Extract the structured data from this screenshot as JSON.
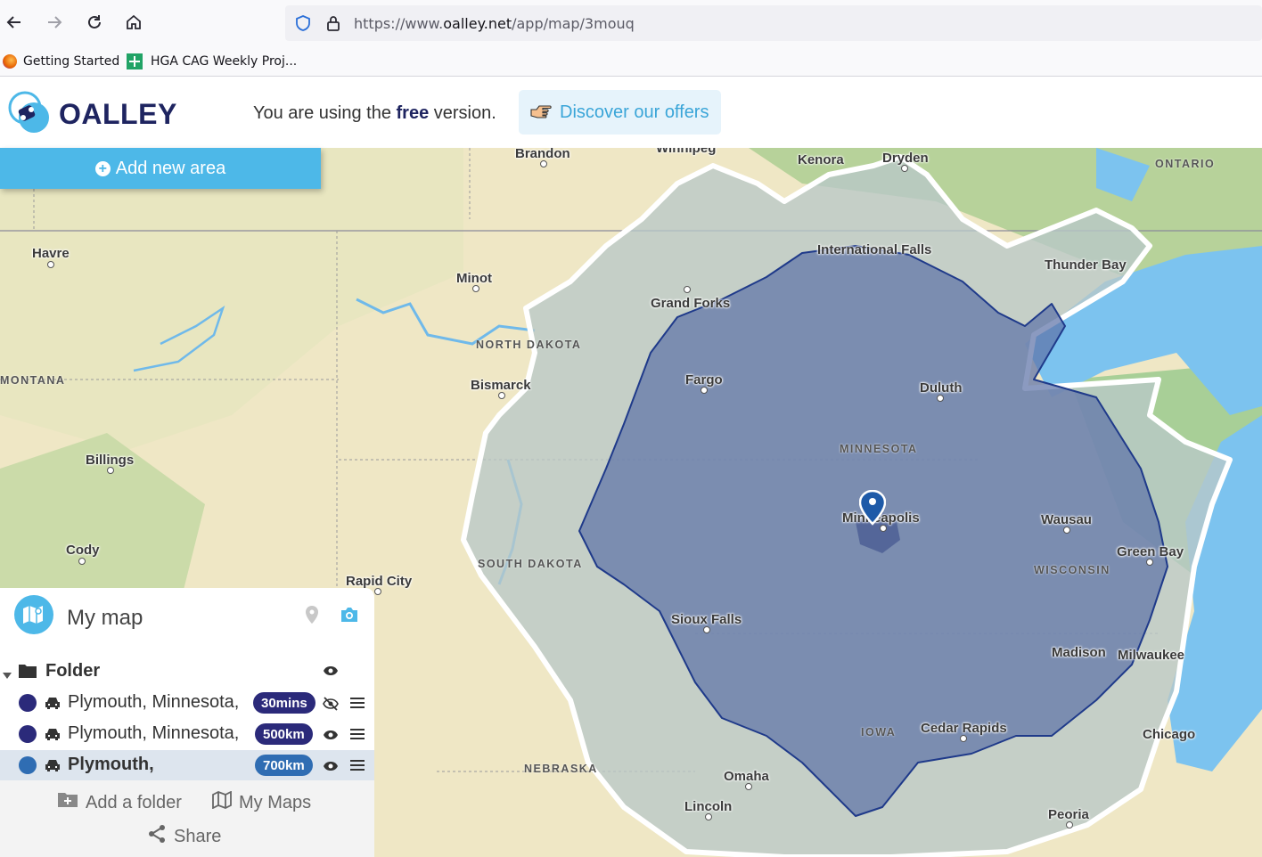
{
  "browser": {
    "url_prefix": "https://www.",
    "url_domain": "oalley.net",
    "url_path": "/app/map/3mouq",
    "bookmarks": [
      {
        "label": "Getting Started"
      },
      {
        "label": "HGA CAG Weekly Proj..."
      }
    ]
  },
  "header": {
    "logo_text": "OALLEY",
    "free_prefix": "You are using the ",
    "free_word": "free",
    "free_suffix": " version.",
    "offers_label": "Discover our offers"
  },
  "toolbar": {
    "add_area_label": "Add new area"
  },
  "map": {
    "cities": [
      {
        "name": "Brandon"
      },
      {
        "name": "Winnipeg"
      },
      {
        "name": "Kenora"
      },
      {
        "name": "Dryden"
      },
      {
        "name": "Havre"
      },
      {
        "name": "Minot"
      },
      {
        "name": "International Falls"
      },
      {
        "name": "Thunder Bay"
      },
      {
        "name": "Grand Forks"
      },
      {
        "name": "Bismarck"
      },
      {
        "name": "Fargo"
      },
      {
        "name": "Duluth"
      },
      {
        "name": "Billings"
      },
      {
        "name": "Minneapolis"
      },
      {
        "name": "Wausau"
      },
      {
        "name": "Cody"
      },
      {
        "name": "Green Bay"
      },
      {
        "name": "Rapid City"
      },
      {
        "name": "Sioux Falls"
      },
      {
        "name": "Madison"
      },
      {
        "name": "Milwaukee"
      },
      {
        "name": "Cedar Rapids"
      },
      {
        "name": "Chicago"
      },
      {
        "name": "Omaha"
      },
      {
        "name": "Lincoln"
      },
      {
        "name": "Peoria"
      }
    ],
    "regions": [
      {
        "name": "ONTARIO"
      },
      {
        "name": "NORTH DAKOTA"
      },
      {
        "name": "MONTANA"
      },
      {
        "name": "MINNESOTA"
      },
      {
        "name": "SOUTH DAKOTA"
      },
      {
        "name": "WISCONSIN"
      },
      {
        "name": "IOWA"
      },
      {
        "name": "NEBRASKA"
      }
    ],
    "colors": {
      "outer": "#b8c4d4",
      "middle": "#8a9cbf",
      "inner": "#4a5d9c",
      "marker": "#1e5aa8"
    }
  },
  "panel": {
    "title": "My map",
    "folder": {
      "name": "Folder"
    },
    "items": [
      {
        "label": "Plymouth, Minnesota,",
        "badge": "30mins",
        "color": "#2b2a7a",
        "badge_color": "#2b2a7a",
        "visible": false,
        "selected": false
      },
      {
        "label": "Plymouth, Minnesota,",
        "badge": "500km",
        "color": "#2b2a7a",
        "badge_color": "#2b2a7a",
        "visible": true,
        "selected": false
      },
      {
        "label": "Plymouth,",
        "badge": "700km",
        "color": "#2f6db3",
        "badge_color": "#2f6db3",
        "visible": true,
        "selected": true
      }
    ],
    "footer": {
      "add_folder": "Add a folder",
      "my_maps": "My Maps",
      "share": "Share"
    }
  }
}
